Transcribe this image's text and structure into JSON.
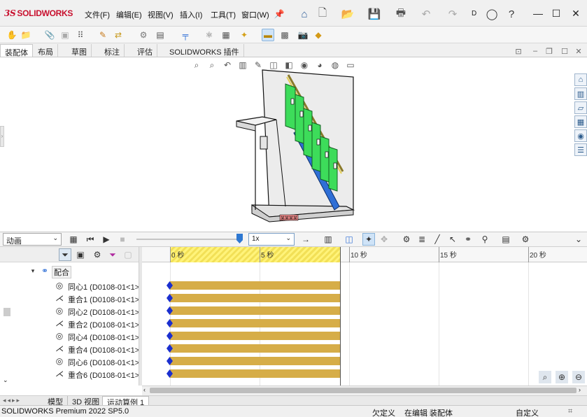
{
  "app": {
    "logo_prefix": "3S",
    "logo_text": "SOLIDWORKS",
    "user_initial": "D"
  },
  "menu": [
    {
      "label": "文件(F)"
    },
    {
      "label": "编辑(E)"
    },
    {
      "label": "视图(V)"
    },
    {
      "label": "插入(I)"
    },
    {
      "label": "工具(T)"
    },
    {
      "label": "窗口(W)"
    }
  ],
  "tabs": [
    "装配体",
    "布局",
    "草图",
    "标注",
    "评估",
    "SOLIDWORKS 插件"
  ],
  "model": {
    "label": "某某某某"
  },
  "motion": {
    "study_type": "动画",
    "speed": "1x",
    "timeline_end_seconds": 5,
    "current_time_seconds": 5
  },
  "timeline": {
    "ticks": [
      {
        "label": "0 秒",
        "seconds": 0
      },
      {
        "label": "5 秒",
        "seconds": 5
      },
      {
        "label": "10 秒",
        "seconds": 10
      },
      {
        "label": "15 秒",
        "seconds": 15
      },
      {
        "label": "20 秒",
        "seconds": 20
      }
    ]
  },
  "tree": {
    "group_label": "配合",
    "items": [
      {
        "label": "同心1 (D0108-01<1>",
        "icon": "concentric-icon"
      },
      {
        "label": "重合1 (D0108-01<1>",
        "icon": "coincident-icon"
      },
      {
        "label": "同心2 (D0108-01<1>",
        "icon": "concentric-icon"
      },
      {
        "label": "重合2 (D0108-01<1>",
        "icon": "coincident-icon"
      },
      {
        "label": "同心4 (D0108-01<1>",
        "icon": "concentric-icon"
      },
      {
        "label": "重合4 (D0108-01<1>",
        "icon": "coincident-icon"
      },
      {
        "label": "同心6 (D0108-01<1>",
        "icon": "concentric-icon"
      },
      {
        "label": "重合6 (D0108-01<1>",
        "icon": "coincident-icon"
      }
    ]
  },
  "bottom_tabs": [
    "模型",
    "3D 视图",
    "运动算例 1"
  ],
  "status": {
    "product": "SOLIDWORKS Premium 2022 SP5.0",
    "definition": "欠定义",
    "mode": "在编辑 装配体",
    "units": "自定义"
  },
  "colors": {
    "bar": "#d6ad48",
    "key": "#1b2fcf",
    "hatch": "#fff37a",
    "part_green": "#3ddc5a",
    "part_blue": "#2f6fd6",
    "logo_red": "#c8102e"
  }
}
